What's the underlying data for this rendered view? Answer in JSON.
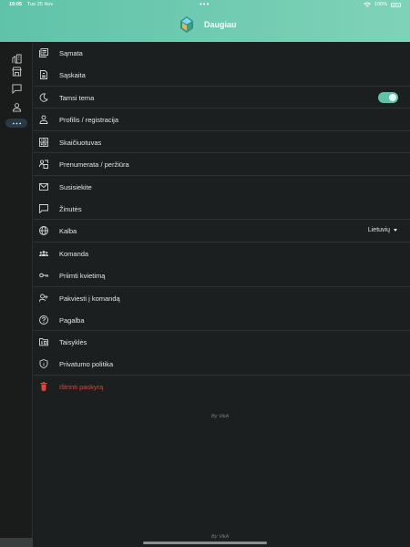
{
  "status_bar": {
    "time": "19:05",
    "date": "Tue 25 Nov",
    "dots": "•••",
    "battery": "100%"
  },
  "header": {
    "app_title": "Daugiau",
    "logo_icon": "house-logo-icon"
  },
  "colors": {
    "header_start": "#5fc3a9",
    "header_end": "#7fd2b7",
    "background": "#1c1f1f",
    "accent": "#5fc3a9",
    "danger": "#e0443a"
  },
  "rail": {
    "items": [
      {
        "icon": "chart-building-icon"
      },
      {
        "icon": "store-icon"
      },
      {
        "icon": "chat-icon"
      },
      {
        "icon": "person-icon"
      },
      {
        "icon": "more-dots-icon",
        "active": true
      }
    ]
  },
  "menu": {
    "items": [
      {
        "label": "Sąmata",
        "icon": "document-stack-icon"
      },
      {
        "label": "Sąskaita",
        "icon": "invoice-icon"
      },
      {
        "label": "Tamsi tema",
        "icon": "moon-icon",
        "toggle_on": true
      },
      {
        "label": "Profilis / registracija",
        "icon": "person-icon"
      },
      {
        "label": "Skaičiuotuvas",
        "icon": "calculator-icon"
      },
      {
        "label": "Prenumerata / peržiūra",
        "icon": "subscription-icon"
      },
      {
        "label": "Susisiekite",
        "icon": "mail-icon"
      },
      {
        "label": "Žinutės",
        "icon": "chat-icon"
      },
      {
        "label": "Kalba",
        "icon": "globe-icon",
        "value": "Lietuvių"
      },
      {
        "label": "Komanda",
        "icon": "team-icon"
      },
      {
        "label": "Priimti kvietimą",
        "icon": "key-icon"
      },
      {
        "label": "Pakviesti į komandą",
        "icon": "add-person-icon"
      },
      {
        "label": "Pagalba",
        "icon": "help-icon"
      },
      {
        "label": "Taisyklės",
        "icon": "folder-rules-icon"
      },
      {
        "label": "Privatumo politika",
        "icon": "shield-icon"
      },
      {
        "label": "Ištrinti paskyrą",
        "icon": "trash-icon",
        "danger": true
      }
    ]
  },
  "footer": {
    "by_text": "By VikA",
    "by_text_bottom": "By VikA"
  }
}
